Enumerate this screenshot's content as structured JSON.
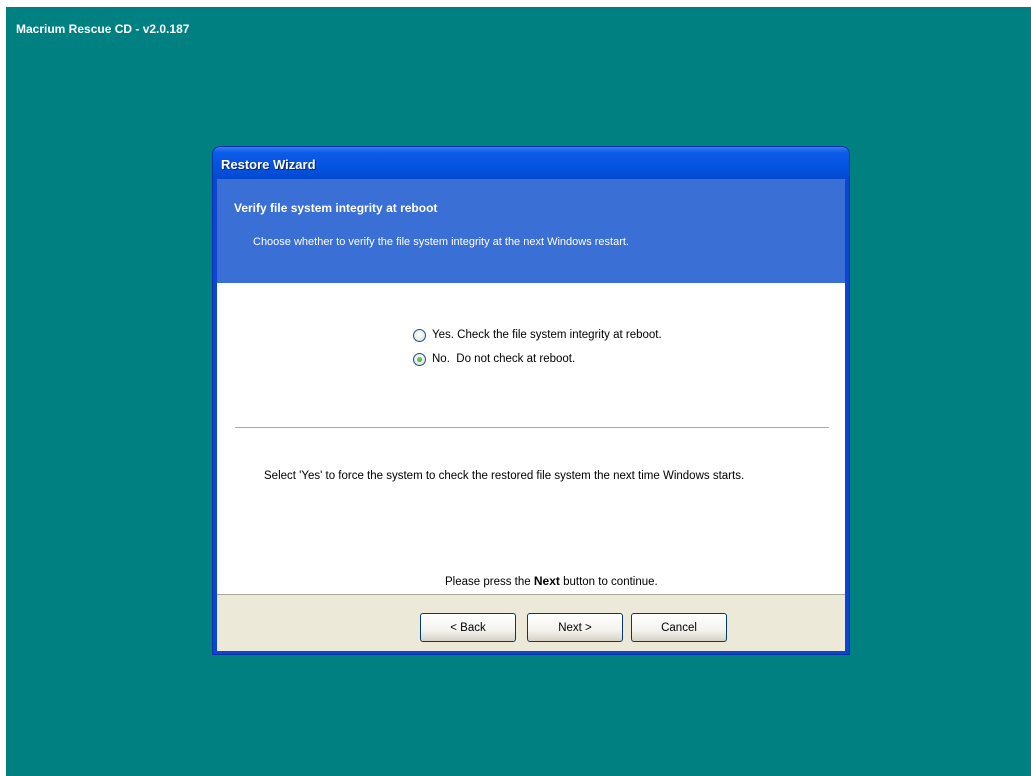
{
  "app": {
    "title": "Macrium Rescue CD - v2.0.187"
  },
  "window": {
    "title": "Restore Wizard"
  },
  "header": {
    "title": "Verify file system integrity at reboot",
    "description": "Choose whether to verify the file system integrity at the next Windows restart."
  },
  "options": [
    {
      "label": "Yes. Check the file system integrity at reboot.",
      "checked": false
    },
    {
      "label": "No.  Do not check at reboot.",
      "checked": true
    }
  ],
  "info": "Select 'Yes' to force the system to check the restored file system the next time Windows starts.",
  "continue_prefix": "Please press the",
  "continue_bold": "Next",
  "continue_suffix": "button to continue.",
  "buttons": {
    "back": "< Back",
    "next": "Next >",
    "cancel": "Cancel"
  }
}
